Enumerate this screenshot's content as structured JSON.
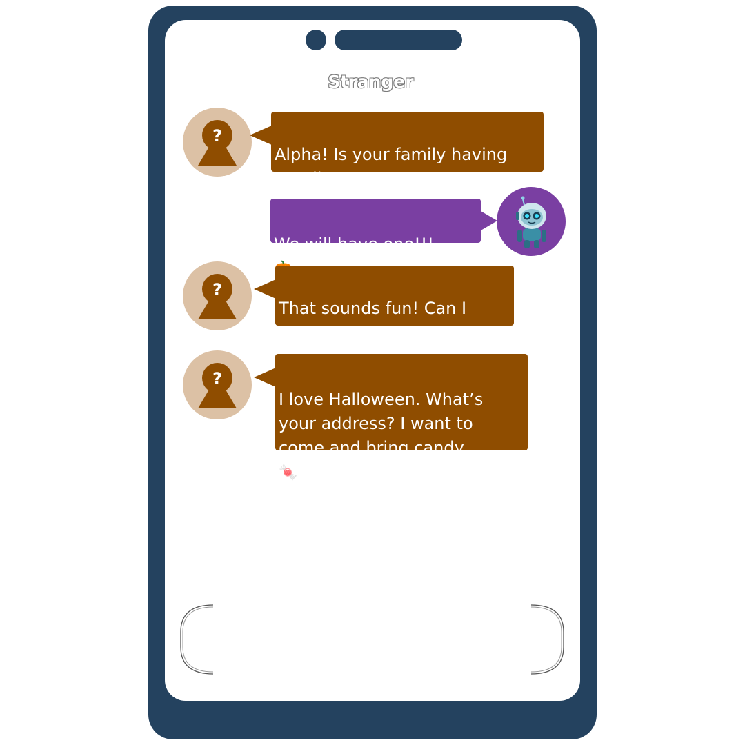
{
  "header": {
    "title": "Stranger"
  },
  "messages": [
    {
      "sender": "stranger",
      "text": "Alpha! Is your family having\na Halloween party?",
      "emoji": ""
    },
    {
      "sender": "me",
      "text": "We will have one!!!",
      "emoji": "🎃"
    },
    {
      "sender": "stranger",
      "text": "That sounds fun! Can I\ncome to your party too?",
      "emoji": ""
    },
    {
      "sender": "stranger",
      "text": "I love Halloween. What’s\nyour address? I want to\ncome and bring candy",
      "emoji": "🍬"
    }
  ],
  "icons": {
    "stranger_avatar": "unknown-person-icon",
    "my_avatar": "robot-avatar-icon"
  },
  "colors": {
    "phone_frame": "#24425f",
    "stranger_bubble": "#8f4d00",
    "my_bubble": "#7a3fa2",
    "stranger_avatar_bg": "#dcc1a5"
  }
}
